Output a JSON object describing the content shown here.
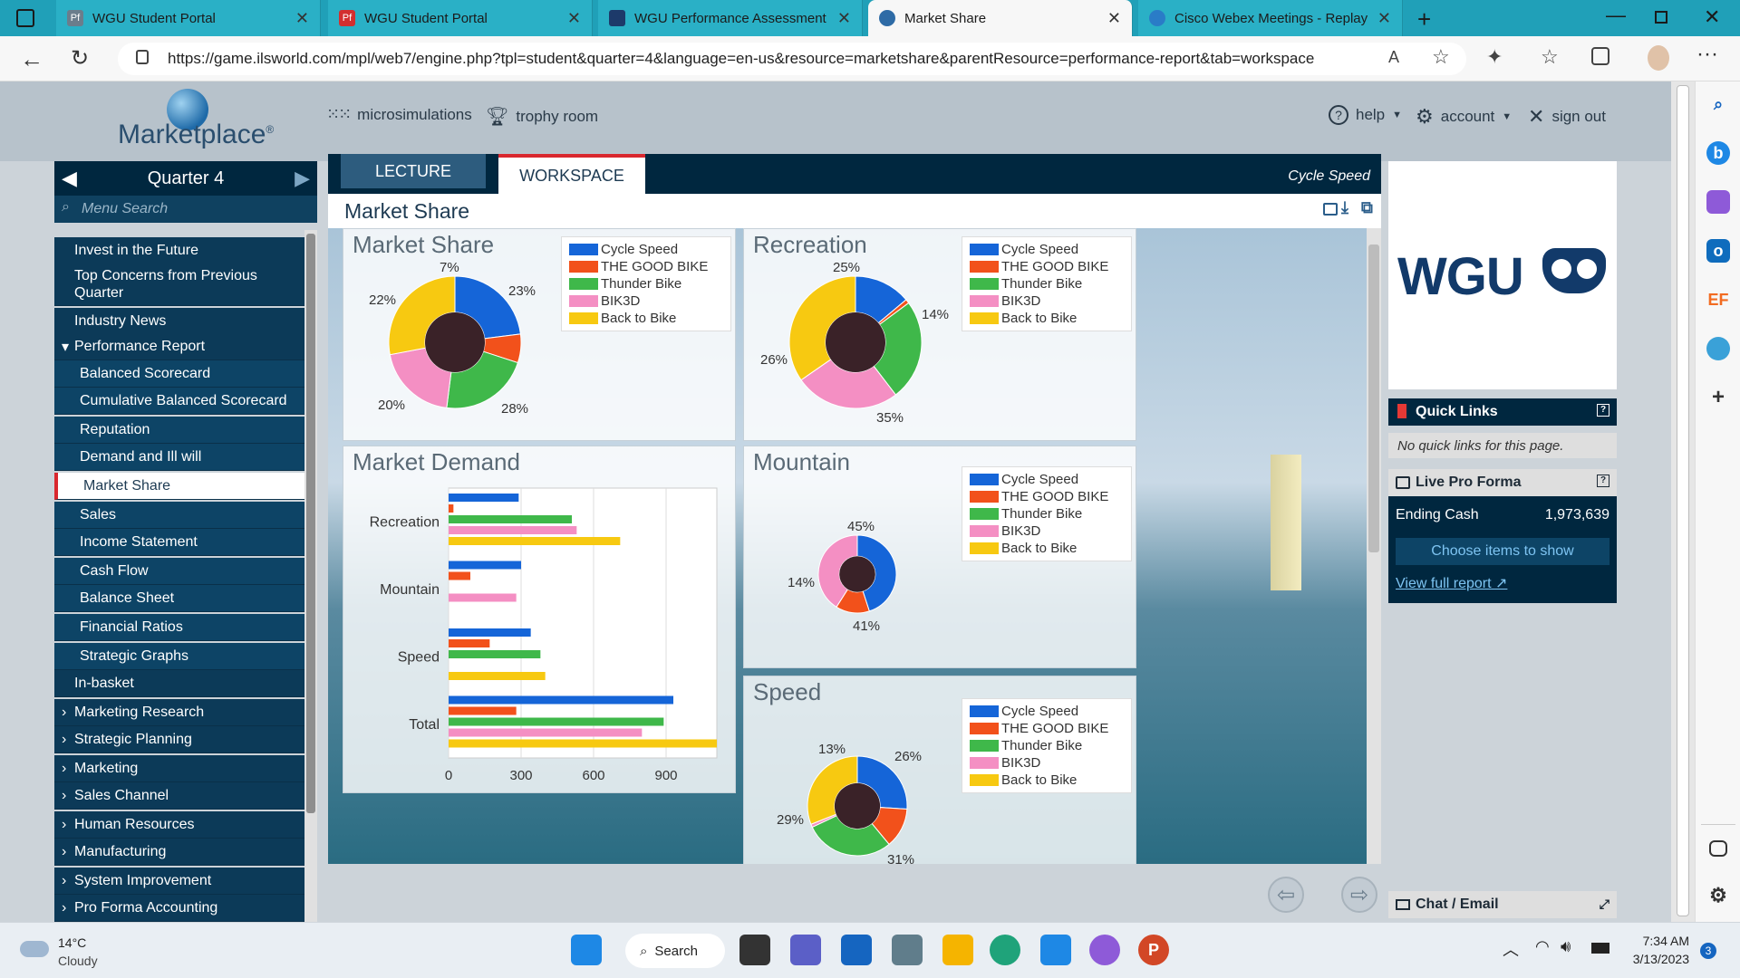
{
  "browser": {
    "tabs": [
      {
        "label": "WGU Student Portal",
        "fav": "Pf",
        "color": "#6b7d8c"
      },
      {
        "label": "WGU Student Portal",
        "fav": "Pf",
        "color": "#d32f2f"
      },
      {
        "label": "WGU Performance Assessment",
        "fav": "owl",
        "color": "#1d3a6a"
      },
      {
        "label": "Market Share",
        "fav": "globe",
        "color": "#2e6ba6"
      },
      {
        "label": "Cisco Webex Meetings - Replay P",
        "fav": "webex",
        "color": "#2a7cc7"
      }
    ],
    "url": "https://game.ilsworld.com/mpl/web7/engine.php?tpl=student&quarter=4&language=en-us&resource=marketshare&parentResource=performance-report&tab=workspace"
  },
  "topnav": {
    "logo": "Marketplace",
    "logo_reg": "®",
    "microsimulations": "microsimulations",
    "trophy": "trophy room",
    "help": "help",
    "account": "account",
    "signout": "sign out"
  },
  "menu": {
    "quarter": "Quarter 4",
    "search_placeholder": "Menu Search",
    "items": [
      {
        "label": "Invest in the Future",
        "kind": "top"
      },
      {
        "label": "Top Concerns from Previous Quarter",
        "kind": "top"
      },
      {
        "label": "Industry News",
        "kind": "top"
      },
      {
        "label": "Performance Report",
        "kind": "expanded"
      },
      {
        "label": "Balanced Scorecard",
        "kind": "sub"
      },
      {
        "label": "Cumulative Balanced Scorecard",
        "kind": "sub"
      },
      {
        "label": "Reputation",
        "kind": "sub"
      },
      {
        "label": "Demand and Ill will",
        "kind": "sub"
      },
      {
        "label": "Market Share",
        "kind": "active"
      },
      {
        "label": "Sales",
        "kind": "sub"
      },
      {
        "label": "Income Statement",
        "kind": "sub"
      },
      {
        "label": "Cash Flow",
        "kind": "sub"
      },
      {
        "label": "Balance Sheet",
        "kind": "sub"
      },
      {
        "label": "Financial Ratios",
        "kind": "sub"
      },
      {
        "label": "Strategic Graphs",
        "kind": "sub"
      },
      {
        "label": "In-basket",
        "kind": "top"
      },
      {
        "label": "Marketing Research",
        "kind": "collapsed"
      },
      {
        "label": "Strategic Planning",
        "kind": "collapsed"
      },
      {
        "label": "Marketing",
        "kind": "collapsed"
      },
      {
        "label": "Sales Channel",
        "kind": "collapsed"
      },
      {
        "label": "Human Resources",
        "kind": "collapsed"
      },
      {
        "label": "Manufacturing",
        "kind": "collapsed"
      },
      {
        "label": "System Improvement",
        "kind": "collapsed"
      },
      {
        "label": "Pro Forma Accounting",
        "kind": "collapsed"
      }
    ]
  },
  "workspace": {
    "tab_lecture": "LECTURE",
    "tab_workspace": "WORKSPACE",
    "company": "Cycle Speed",
    "page_title": "Market Share"
  },
  "legend": [
    "Cycle Speed",
    "THE GOOD BIKE",
    "Thunder Bike",
    "BIK3D",
    "Back to Bike"
  ],
  "colors": {
    "cycle": "#1565d8",
    "good": "#f2511b",
    "thunder": "#3fb84a",
    "bik3d": "#f48fc3",
    "back": "#f7c911"
  },
  "chart_data": [
    {
      "type": "pie",
      "title": "Market Share",
      "labels": [
        "Cycle Speed",
        "THE GOOD BIKE",
        "Thunder Bike",
        "BIK3D",
        "Back to Bike"
      ],
      "values": [
        23,
        7,
        22,
        20,
        28
      ],
      "pct_labels": [
        "23%",
        "7%",
        "22%",
        "20%",
        "28%"
      ]
    },
    {
      "type": "pie",
      "title": "Recreation",
      "labels": [
        "Cycle Speed",
        "THE GOOD BIKE",
        "Thunder Bike",
        "BIK3D",
        "Back to Bike"
      ],
      "values": [
        14,
        1,
        25,
        26,
        35
      ],
      "pct_labels": [
        "14%",
        "",
        "25%",
        "26%",
        "35%"
      ]
    },
    {
      "type": "pie",
      "title": "Mountain",
      "labels": [
        "Cycle Speed",
        "THE GOOD BIKE",
        "Thunder Bike",
        "BIK3D",
        "Back to Bike"
      ],
      "values": [
        45,
        14,
        0,
        41,
        0
      ],
      "pct_labels": [
        "45%",
        "14%",
        "",
        "41%",
        ""
      ]
    },
    {
      "type": "pie",
      "title": "Speed",
      "labels": [
        "Cycle Speed",
        "THE GOOD BIKE",
        "Thunder Bike",
        "BIK3D",
        "Back to Bike"
      ],
      "values": [
        26,
        13,
        29,
        1,
        31
      ],
      "pct_labels": [
        "26%",
        "13%",
        "29%",
        "",
        "31%"
      ]
    },
    {
      "type": "bar",
      "title": "Market Demand",
      "categories": [
        "Recreation",
        "Mountain",
        "Speed",
        "Total"
      ],
      "series": [
        {
          "name": "Cycle Speed",
          "values": [
            290,
            300,
            340,
            930
          ]
        },
        {
          "name": "THE GOOD BIKE",
          "values": [
            20,
            90,
            170,
            280
          ]
        },
        {
          "name": "Thunder Bike",
          "values": [
            510,
            0,
            380,
            890
          ]
        },
        {
          "name": "BIK3D",
          "values": [
            530,
            280,
            0,
            800
          ]
        },
        {
          "name": "Back to Bike",
          "values": [
            710,
            0,
            400,
            1110
          ]
        }
      ],
      "xticks": [
        "0",
        "300",
        "600",
        "900"
      ],
      "xlim": [
        0,
        1110
      ]
    }
  ],
  "right": {
    "wgu": "WGU",
    "quick_links": "Quick Links",
    "quick_note": "No quick links for this page.",
    "live_pro_forma": "Live Pro Forma",
    "ending_cash_label": "Ending Cash",
    "ending_cash_value": "1,973,639",
    "choose_items": "Choose items to show",
    "view_report": "View full report",
    "chat": "Chat",
    "email": "/ Email"
  },
  "taskbar": {
    "temp": "14°C",
    "weather": "Cloudy",
    "search": "Search",
    "time": "7:34 AM",
    "date": "3/13/2023",
    "badge": "3"
  }
}
